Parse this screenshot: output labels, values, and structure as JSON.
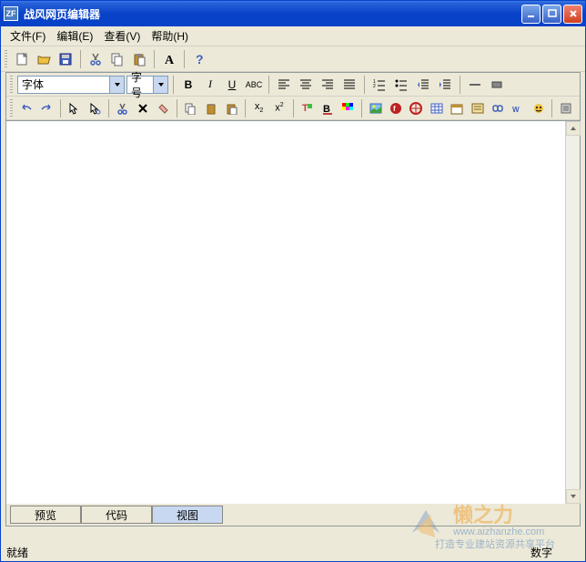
{
  "window": {
    "title": "战风网页编辑器",
    "icon_label": "ZF"
  },
  "menu": {
    "file": "文件(F)",
    "edit": "编辑(E)",
    "view": "查看(V)",
    "help": "帮助(H)"
  },
  "toolbar2": {
    "font_label": "字体",
    "size_label": "字号"
  },
  "tabs": {
    "preview": "预览",
    "code": "代码",
    "view": "视图"
  },
  "status": {
    "ready": "就绪",
    "num": "数字"
  },
  "watermark": {
    "brand": "懒之力",
    "url": "www.aizhanzhe.com",
    "tagline": "打造专业建站资源共享平台"
  }
}
